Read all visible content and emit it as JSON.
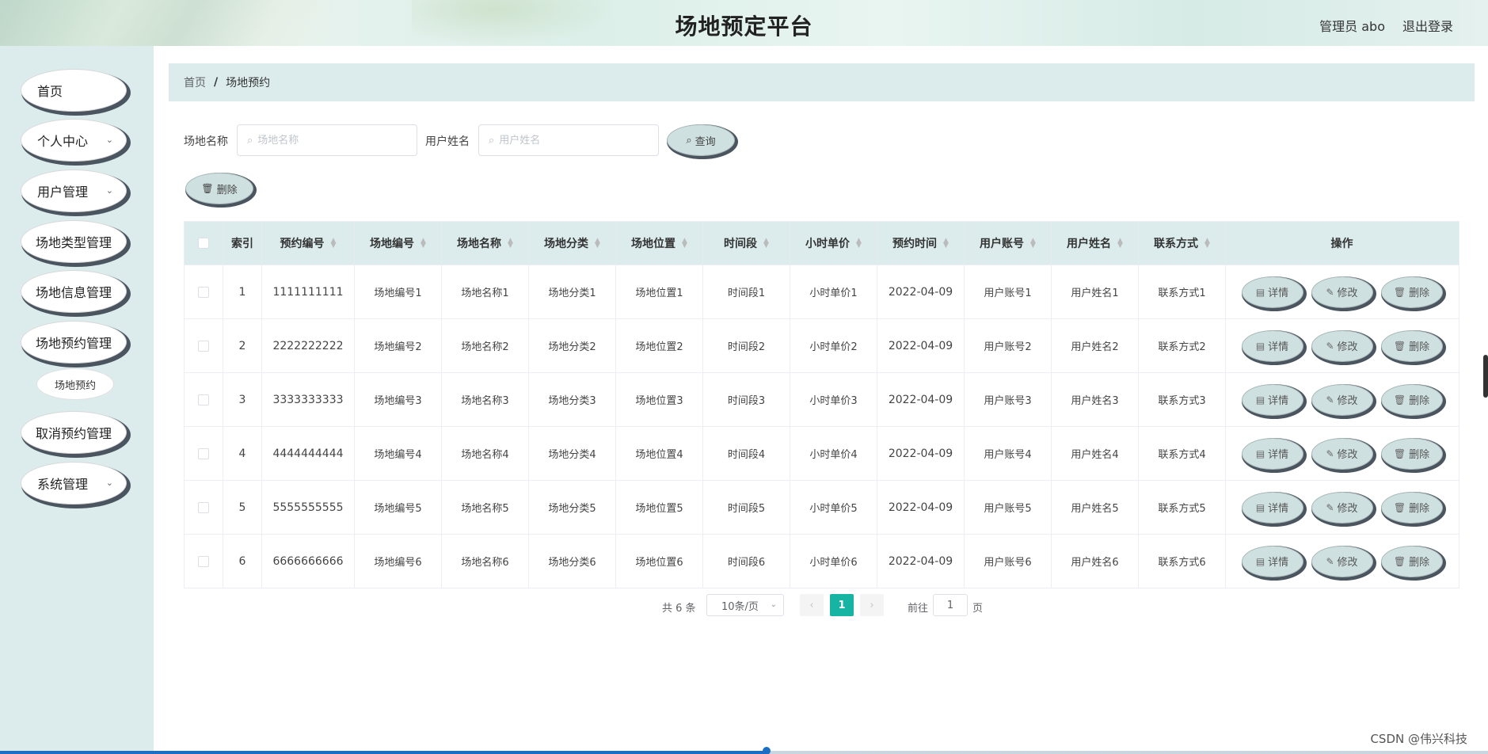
{
  "header": {
    "title": "场地预定平台",
    "user": "管理员 abo",
    "logout": "退出登录"
  },
  "sidebar": {
    "items": [
      {
        "label": "首页",
        "chev": ""
      },
      {
        "label": "个人中心",
        "chev": "⌄"
      },
      {
        "label": "用户管理",
        "chev": "⌄"
      },
      {
        "label": "场地类型管理",
        "chev": ""
      },
      {
        "label": "场地信息管理",
        "chev": ""
      },
      {
        "label": "场地预约管理",
        "chev": ""
      },
      {
        "label": "取消预约管理",
        "chev": ""
      },
      {
        "label": "系统管理",
        "chev": "⌄"
      }
    ],
    "sub_item": "场地预约"
  },
  "breadcrumb": {
    "home": "首页",
    "sep": "/",
    "current": "场地预约"
  },
  "search": {
    "venue_label": "场地名称",
    "venue_placeholder": "场地名称",
    "user_label": "用户姓名",
    "user_placeholder": "用户姓名",
    "query_label": "查询"
  },
  "toolbar": {
    "delete_label": "删除"
  },
  "table": {
    "columns": [
      "",
      "索引",
      "预约编号",
      "场地编号",
      "场地名称",
      "场地分类",
      "场地位置",
      "时间段",
      "小时单价",
      "预约时间",
      "用户账号",
      "用户姓名",
      "联系方式",
      "操作"
    ],
    "rows": [
      [
        "1",
        "1111111111",
        "场地编号1",
        "场地名称1",
        "场地分类1",
        "场地位置1",
        "时间段1",
        "小时单价1",
        "2022-04-09",
        "用户账号1",
        "用户姓名1",
        "联系方式1"
      ],
      [
        "2",
        "2222222222",
        "场地编号2",
        "场地名称2",
        "场地分类2",
        "场地位置2",
        "时间段2",
        "小时单价2",
        "2022-04-09",
        "用户账号2",
        "用户姓名2",
        "联系方式2"
      ],
      [
        "3",
        "3333333333",
        "场地编号3",
        "场地名称3",
        "场地分类3",
        "场地位置3",
        "时间段3",
        "小时单价3",
        "2022-04-09",
        "用户账号3",
        "用户姓名3",
        "联系方式3"
      ],
      [
        "4",
        "4444444444",
        "场地编号4",
        "场地名称4",
        "场地分类4",
        "场地位置4",
        "时间段4",
        "小时单价4",
        "2022-04-09",
        "用户账号4",
        "用户姓名4",
        "联系方式4"
      ],
      [
        "5",
        "5555555555",
        "场地编号5",
        "场地名称5",
        "场地分类5",
        "场地位置5",
        "时间段5",
        "小时单价5",
        "2022-04-09",
        "用户账号5",
        "用户姓名5",
        "联系方式5"
      ],
      [
        "6",
        "6666666666",
        "场地编号6",
        "场地名称6",
        "场地分类6",
        "场地位置6",
        "时间段6",
        "小时单价6",
        "2022-04-09",
        "用户账号6",
        "用户姓名6",
        "联系方式6"
      ]
    ],
    "actions": {
      "detail": "详情",
      "edit": "修改",
      "delete": "删除"
    }
  },
  "pagination": {
    "total": "共 6 条",
    "page_size": "10条/页",
    "current_page": "1",
    "goto_label": "前往",
    "goto_value": "1",
    "goto_unit": "页"
  },
  "watermark": "CSDN @伟兴科技",
  "colors": {
    "accent": "#17b3a3",
    "panel": "#dcecec",
    "button": "#cfe0e0",
    "progress": "#1a6fc4"
  }
}
